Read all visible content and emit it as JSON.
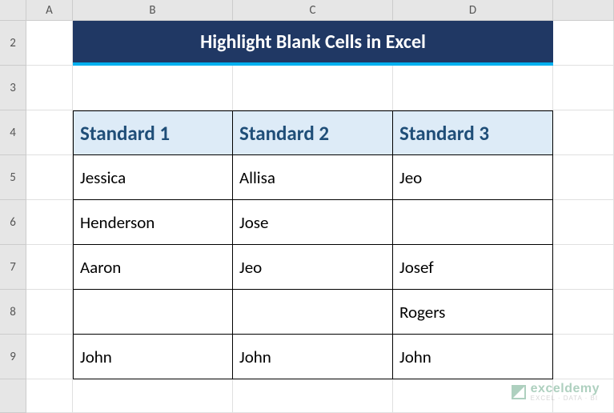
{
  "columns": [
    "A",
    "B",
    "C",
    "D"
  ],
  "rows": [
    "2",
    "3",
    "4",
    "5",
    "6",
    "7",
    "8",
    "9"
  ],
  "title": "Highlight Blank Cells in Excel",
  "headers": [
    "Standard 1",
    "Standard 2",
    "Standard 3"
  ],
  "chart_data": {
    "type": "table",
    "title": "Highlight Blank Cells in Excel",
    "columns": [
      "Standard 1",
      "Standard 2",
      "Standard 3"
    ],
    "rows": [
      [
        "Jessica",
        "Allisa",
        "Jeo"
      ],
      [
        "Henderson",
        "Jose",
        ""
      ],
      [
        "Aaron",
        "Jeo",
        "Josef"
      ],
      [
        "",
        "",
        "Rogers"
      ],
      [
        "John",
        "John",
        "John"
      ]
    ]
  },
  "watermark": {
    "main": "exceldemy",
    "sub": "EXCEL · DATA · BI"
  }
}
